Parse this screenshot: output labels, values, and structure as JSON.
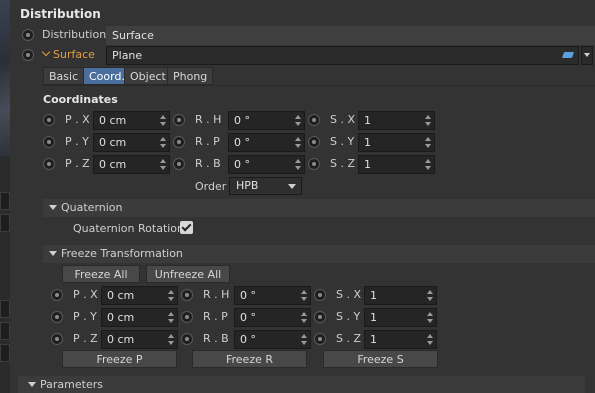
{
  "title": "Distribution",
  "distribution": {
    "label": "Distribution",
    "value": "Surface"
  },
  "surface": {
    "label": "Surface",
    "value": "Plane"
  },
  "tabs": [
    "Basic",
    "Coord.",
    "Object",
    "Phong"
  ],
  "coordinates": {
    "heading": "Coordinates",
    "rows": [
      {
        "p_label": "P . X",
        "p_val": "0 cm",
        "r_label": "R . H",
        "r_val": "0 °",
        "s_label": "S . X",
        "s_val": "1"
      },
      {
        "p_label": "P . Y",
        "p_val": "0 cm",
        "r_label": "R . P",
        "r_val": "0 °",
        "s_label": "S . Y",
        "s_val": "1"
      },
      {
        "p_label": "P . Z",
        "p_val": "0 cm",
        "r_label": "R . B",
        "r_val": "0 °",
        "s_label": "S . Z",
        "s_val": "1"
      }
    ],
    "order_label": "Order",
    "order_value": "HPB"
  },
  "quaternion": {
    "heading": "Quaternion",
    "rotation_label": "Quaternion Rotation",
    "checked": true
  },
  "freeze": {
    "heading": "Freeze Transformation",
    "freeze_all": "Freeze All",
    "unfreeze_all": "Unfreeze All",
    "rows": [
      {
        "p_label": "P . X",
        "p_val": "0 cm",
        "r_label": "R . H",
        "r_val": "0 °",
        "s_label": "S . X",
        "s_val": "1"
      },
      {
        "p_label": "P . Y",
        "p_val": "0 cm",
        "r_label": "R . P",
        "r_val": "0 °",
        "s_label": "S . Y",
        "s_val": "1"
      },
      {
        "p_label": "P . Z",
        "p_val": "0 cm",
        "r_label": "R . B",
        "r_val": "0 °",
        "s_label": "S . Z",
        "s_val": "1"
      }
    ],
    "freeze_p": "Freeze P",
    "freeze_r": "Freeze R",
    "freeze_s": "Freeze S"
  },
  "parameters": {
    "heading": "Parameters"
  },
  "colors": {
    "accent": "#4b6f9c",
    "surface_label": "#e0a040"
  }
}
